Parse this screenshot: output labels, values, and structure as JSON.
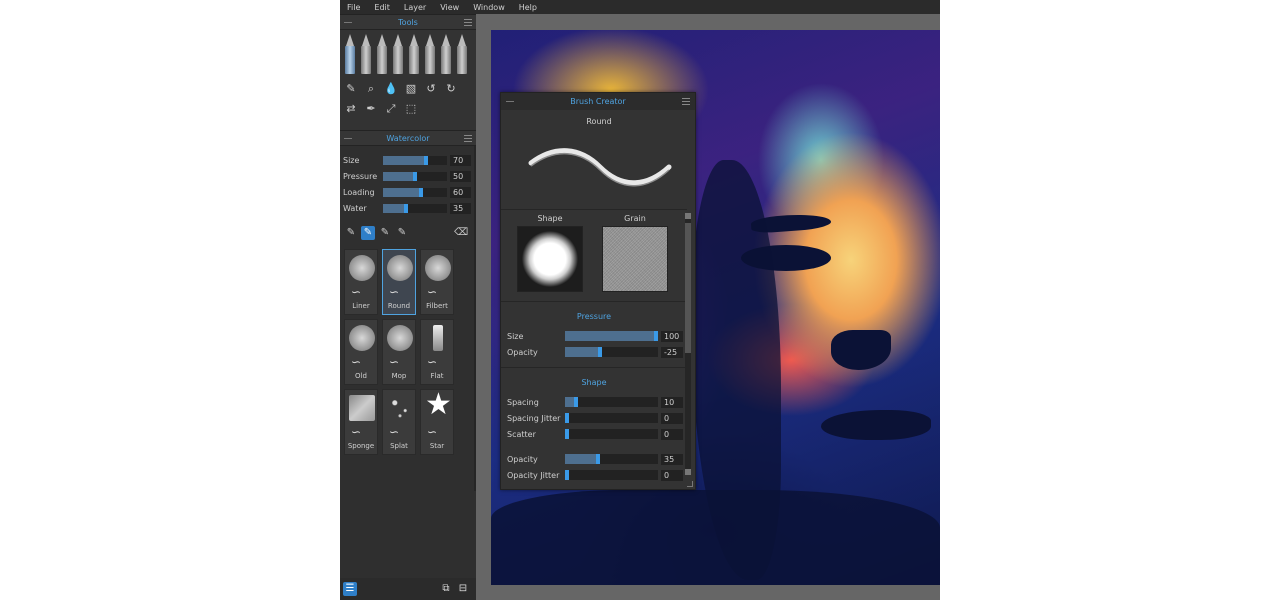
{
  "menu": [
    "File",
    "Edit",
    "Layer",
    "View",
    "Window",
    "Help"
  ],
  "tools_panel": {
    "title": "Tools",
    "pencils": [
      "brush-1",
      "brush-2",
      "brush-3",
      "brush-4",
      "brush-5",
      "brush-6",
      "brush-7",
      "brush-8"
    ],
    "icons_row1": [
      "✎",
      "⌕",
      "💧",
      "▧",
      "↺",
      "↻"
    ],
    "icons_row2": [
      "⇄",
      "✒",
      "⤢",
      "⬚"
    ]
  },
  "watercolor_panel": {
    "title": "Watercolor",
    "sliders": [
      {
        "label": "Size",
        "value": "70",
        "level": 0.68
      },
      {
        "label": "Pressure",
        "value": "50",
        "level": 0.5
      },
      {
        "label": "Loading",
        "value": "60",
        "level": 0.6
      },
      {
        "label": "Water",
        "value": "35",
        "level": 0.35
      }
    ],
    "modes": [
      "✎",
      "✎",
      "✎",
      "✎",
      "⌫"
    ],
    "presets": [
      {
        "name": "Liner"
      },
      {
        "name": "Round"
      },
      {
        "name": "Filbert"
      },
      {
        "name": "Old"
      },
      {
        "name": "Mop"
      },
      {
        "name": "Flat"
      },
      {
        "name": "Sponge"
      },
      {
        "name": "Splat"
      },
      {
        "name": "Star"
      }
    ],
    "selected_preset": "Round"
  },
  "bottom_bar": {
    "left_icon": "☰",
    "right_icon_1": "⧉",
    "right_icon_2": "⊟"
  },
  "brush_creator": {
    "title": "Brush Creator",
    "preset_name": "Round",
    "shape_label": "Shape",
    "grain_label": "Grain",
    "pressure_title": "Pressure",
    "pressure_rows": [
      {
        "label": "Size",
        "value": "100",
        "level": 1.0
      },
      {
        "label": "Opacity",
        "value": "-25",
        "level": 0.37
      }
    ],
    "shape_title": "Shape",
    "shape_rows": [
      {
        "label": "Spacing",
        "value": "10",
        "level": 0.1
      },
      {
        "label": "Spacing Jitter",
        "value": "0",
        "level": 0.0
      },
      {
        "label": "Scatter",
        "value": "0",
        "level": 0.0
      },
      {
        "label": "Opacity",
        "value": "35",
        "level": 0.35
      },
      {
        "label": "Opacity Jitter",
        "value": "0",
        "level": 0.0
      }
    ]
  }
}
